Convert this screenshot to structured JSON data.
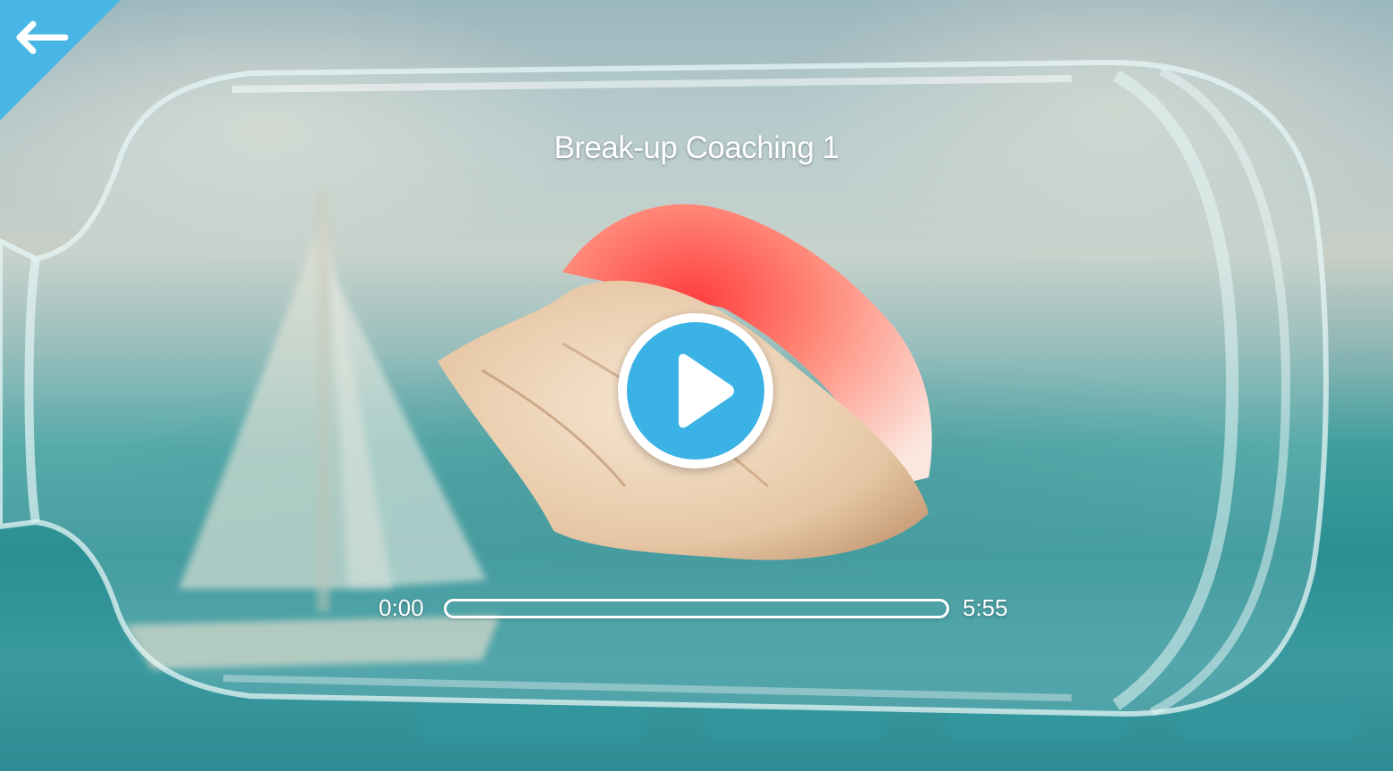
{
  "player": {
    "title": "Break-up Coaching 1",
    "current_time": "0:00",
    "total_time": "5:55",
    "progress": 0
  },
  "icons": {
    "back": "back-arrow-icon",
    "play": "play-icon"
  },
  "colors": {
    "accent": "#3ab2e6",
    "text": "#ffffff"
  }
}
